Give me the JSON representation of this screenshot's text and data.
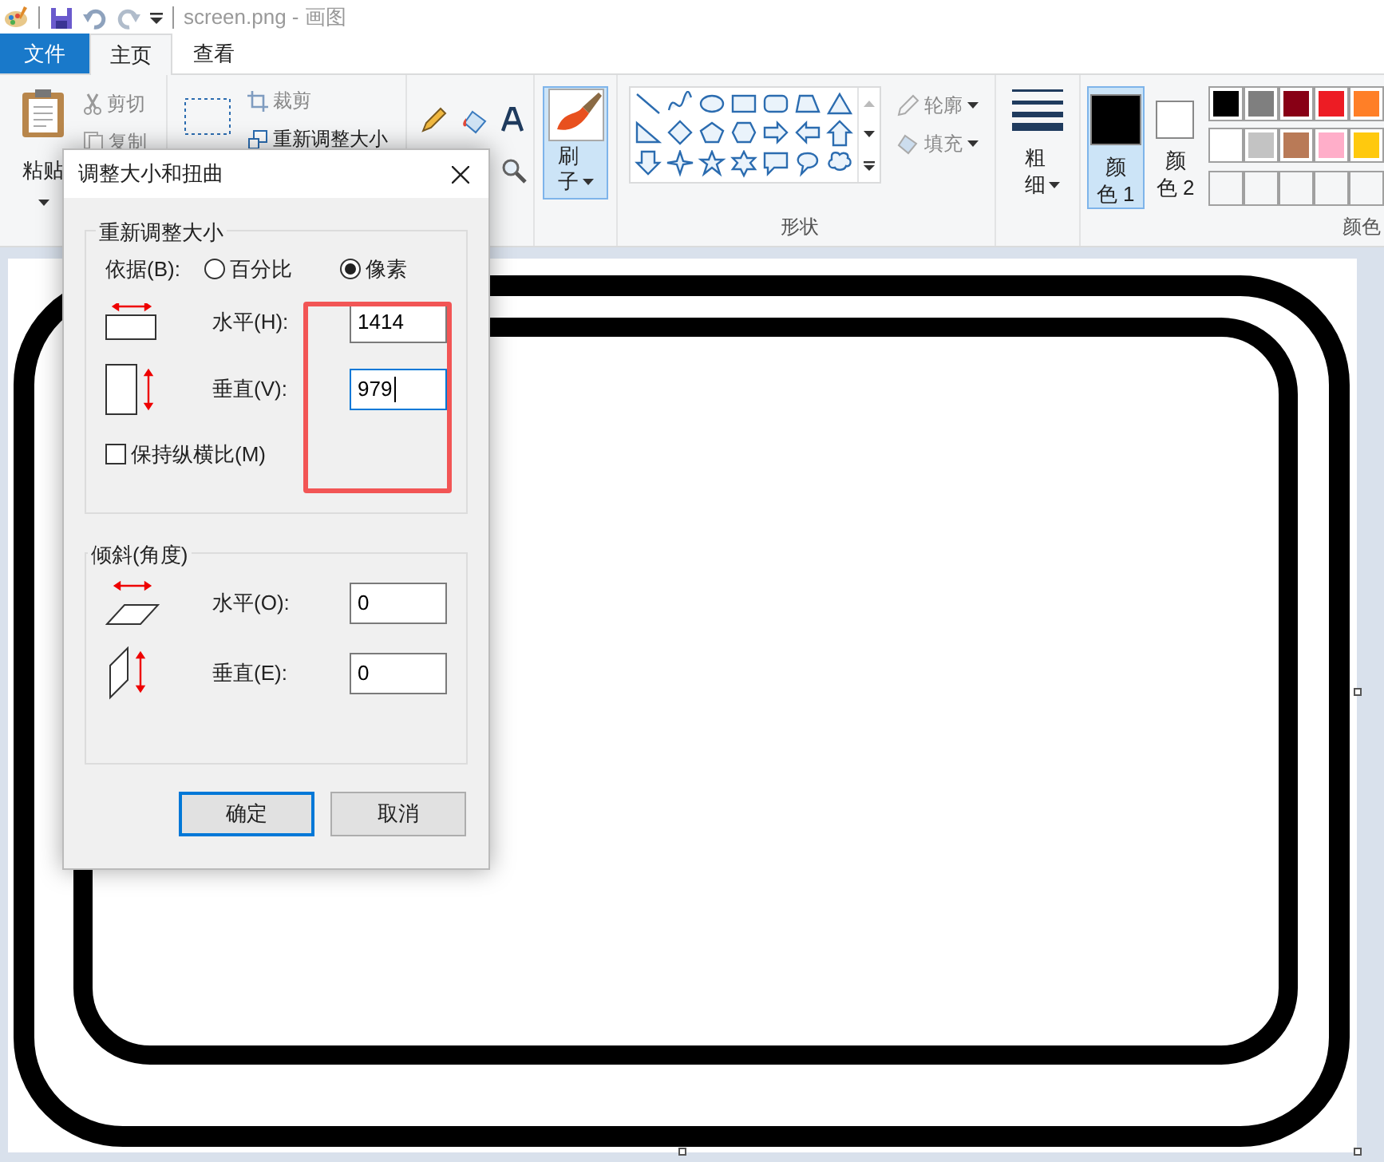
{
  "title_bar": {
    "title": "screen.png - 画图"
  },
  "tabs": [
    {
      "label": "文件",
      "kind": "file",
      "selected": false
    },
    {
      "label": "主页",
      "kind": "tab",
      "selected": true
    },
    {
      "label": "查看",
      "kind": "tab",
      "selected": false
    }
  ],
  "ribbon": {
    "clipboard": {
      "paste": "粘贴",
      "cut": "剪切",
      "copy": "复制"
    },
    "image": {
      "crop": "裁剪",
      "resize": "重新调整大小"
    },
    "brushes": {
      "label": "刷子"
    },
    "shapes": {
      "outline": "轮廓",
      "fill": "填充",
      "group_label": "形状"
    },
    "size": {
      "label": "粗细"
    },
    "colors": {
      "group_label": "颜色",
      "slots": [
        {
          "label": "颜色 1",
          "color": "#000000",
          "selected": true
        },
        {
          "label": "颜色 2",
          "color": "#ffffff",
          "selected": false
        }
      ],
      "palette": [
        {
          "color": "#000000"
        },
        {
          "color": "#7f7f7f"
        },
        {
          "color": "#880015"
        },
        {
          "color": "#ed1c24"
        },
        {
          "color": "#ff7f27"
        },
        {
          "color": "#ffffff"
        },
        {
          "color": "#c3c3c3"
        },
        {
          "color": "#b97a57"
        },
        {
          "color": "#ffaec9"
        },
        {
          "color": "#ffc90e"
        }
      ]
    }
  },
  "dialog": {
    "title": "调整大小和扭曲",
    "resize": {
      "legend": "重新调整大小",
      "by_label": "依据(B):",
      "units": [
        {
          "label": "百分比",
          "selected": false
        },
        {
          "label": "像素",
          "selected": true
        }
      ],
      "horizontal": {
        "label": "水平(H):",
        "value": "1414",
        "focused": false
      },
      "vertical": {
        "label": "垂直(V):",
        "value": "979",
        "focused": true
      },
      "keep_ratio": {
        "label": "保持纵横比(M)",
        "checked": false
      }
    },
    "skew": {
      "legend": "倾斜(角度)",
      "horizontal": {
        "label": "水平(O):",
        "value": "0",
        "focused": false
      },
      "vertical": {
        "label": "垂直(E):",
        "value": "0",
        "focused": false
      }
    },
    "buttons": [
      {
        "label": "确定",
        "default": true
      },
      {
        "label": "取消",
        "default": false
      }
    ]
  }
}
